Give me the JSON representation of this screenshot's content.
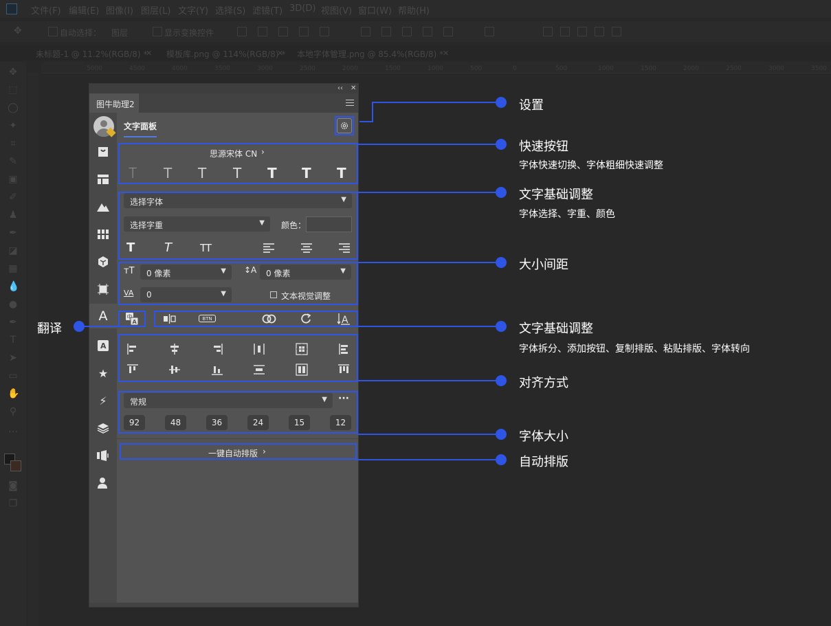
{
  "menubar": {
    "items": [
      "文件(F)",
      "编辑(E)",
      "图像(I)",
      "图层(L)",
      "文字(Y)",
      "选择(S)",
      "滤镜(T)",
      "3D(D)",
      "视图(V)",
      "窗口(W)",
      "帮助(H)"
    ]
  },
  "options_bar": {
    "auto_select": "自动选择：",
    "layer_dropdown": "图层",
    "show_transform": "显示变换控件"
  },
  "document_tabs": [
    "未标题-1 @ 11.2%(RGB/8) *",
    "模板库.png @ 114%(RGB/8) *",
    "本地字体管理.png @ 85.4%(RGB/8) *"
  ],
  "ruler_ticks": [
    "5000",
    "4500",
    "4000",
    "3500",
    "3000",
    "2500",
    "2000",
    "1500",
    "1000",
    "500",
    "0",
    "500",
    "1000",
    "1500",
    "2000",
    "2500",
    "3000",
    "3500"
  ],
  "panel": {
    "tab_label": "图牛助理2",
    "title": "文字面板",
    "settings_icon": "gear-icon",
    "quick": {
      "font_name": "思源宋体 CN",
      "weights_icon": "T"
    },
    "basic": {
      "font_select": "选择字体",
      "weight_select": "选择字重",
      "color_label": "颜色：",
      "color_value": "#464646"
    },
    "spacing": {
      "size_value": "0 像素",
      "leading_value": "0 像素",
      "tracking_value": "0",
      "optical_label": "文本视觉调整"
    },
    "tools": {
      "btn_label": "BTN"
    },
    "font_size": {
      "style": "常规",
      "more": "···",
      "presets": [
        "92",
        "48",
        "36",
        "24",
        "15",
        "12"
      ]
    },
    "auto_layout": {
      "label": "一键自动排版",
      "chevron": "›"
    }
  },
  "annotations": {
    "settings": {
      "title": "设置"
    },
    "quick_buttons": {
      "title": "快速按钮",
      "sub": "字体快速切换、字体粗细快速调整"
    },
    "text_basic_1": {
      "title": "文字基础调整",
      "sub": "字体选择、字重、颜色"
    },
    "size_spacing": {
      "title": "大小间距"
    },
    "text_basic_2": {
      "title": "文字基础调整",
      "sub": "字体拆分、添加按钮、复制排版、粘贴排版、字体转向"
    },
    "alignment": {
      "title": "对齐方式"
    },
    "font_size": {
      "title": "字体大小"
    },
    "auto_layout": {
      "title": "自动排版"
    },
    "translate": {
      "title": "翻译"
    }
  }
}
